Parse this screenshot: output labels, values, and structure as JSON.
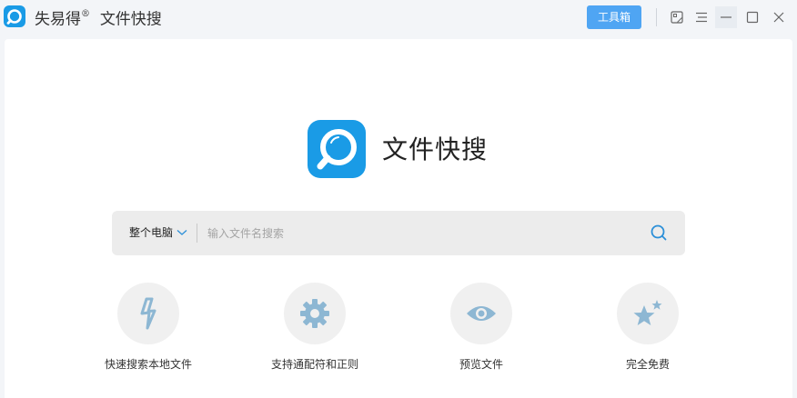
{
  "titlebar": {
    "app_name": "失易得",
    "registered_mark": "®",
    "app_subtitle": "文件快搜",
    "toolbox_label": "工具箱",
    "icons": [
      "app-logo-icon",
      "skin-icon",
      "menu-icon",
      "minimize-icon",
      "maximize-icon",
      "close-icon"
    ]
  },
  "hero": {
    "title": "文件快搜",
    "logo_icon": "magnifier-logo-icon"
  },
  "search": {
    "scope_label": "整个电脑",
    "placeholder": "输入文件名搜索",
    "value": "",
    "icon": "search-icon"
  },
  "features": [
    {
      "label": "快速搜索本地文件",
      "icon": "lightning-icon"
    },
    {
      "label": "支持通配符和正则",
      "icon": "gear-icon"
    },
    {
      "label": "预览文件",
      "icon": "eye-icon"
    },
    {
      "label": "完全免费",
      "icon": "stars-icon"
    }
  ],
  "colors": {
    "accent": "#1a9be6",
    "button": "#4fa5f3",
    "feature_icon": "#8db7d3",
    "feature_bg": "#f0f0f0",
    "search_bg": "#ececec",
    "titlebar_bg": "#f3f5f8"
  }
}
